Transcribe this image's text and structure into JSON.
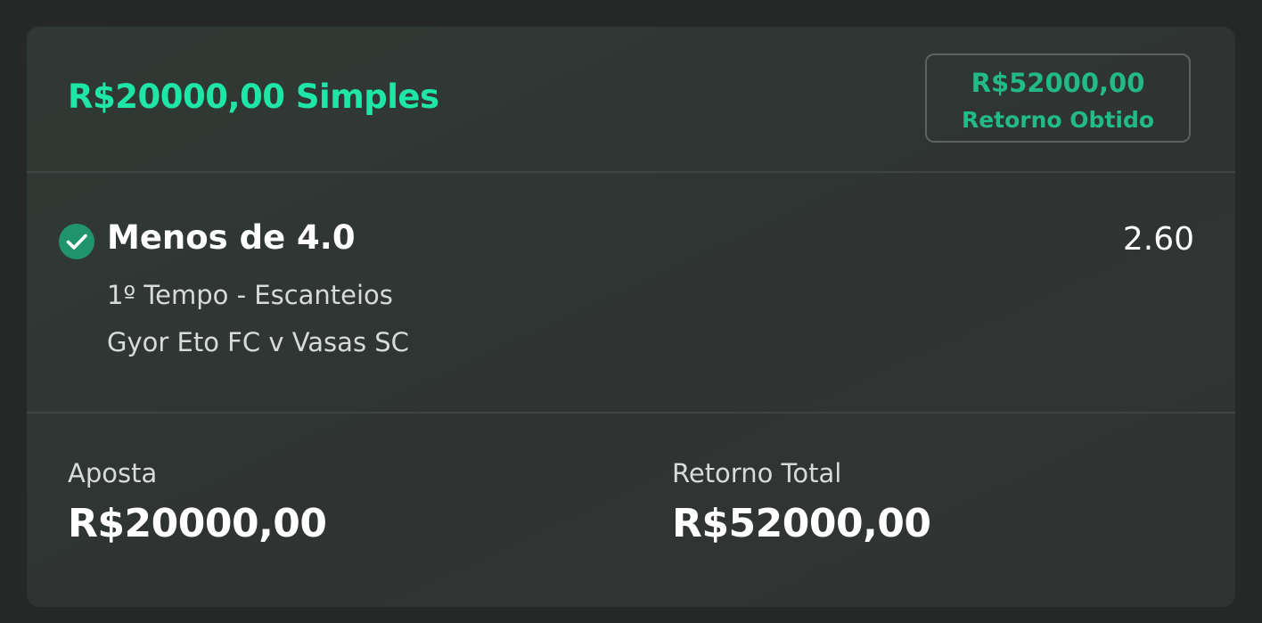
{
  "colors": {
    "page_background": "#262727",
    "card_background": "#303533",
    "title_accent": "#1fe6a6",
    "badge_accent": "#22bb86",
    "check_icon": "#20956d",
    "divider": "#3f4543",
    "badge_border": "#5d625f",
    "primary_text": "#ffffff",
    "secondary_text": "#d9dbda"
  },
  "header": {
    "title": "R$20000,00 Simples",
    "badge": {
      "amount": "R$52000,00",
      "label": "Retorno Obtido"
    }
  },
  "selection": {
    "status_icon": "check-circle-icon",
    "title": "Menos de 4.0",
    "odds": "2.60",
    "market": "1º Tempo - Escanteios",
    "event": "Gyor Eto FC v Vasas SC"
  },
  "summary": {
    "stake_label": "Aposta",
    "stake_value": "R$20000,00",
    "total_return_label": "Retorno Total",
    "total_return_value": "R$52000,00"
  }
}
